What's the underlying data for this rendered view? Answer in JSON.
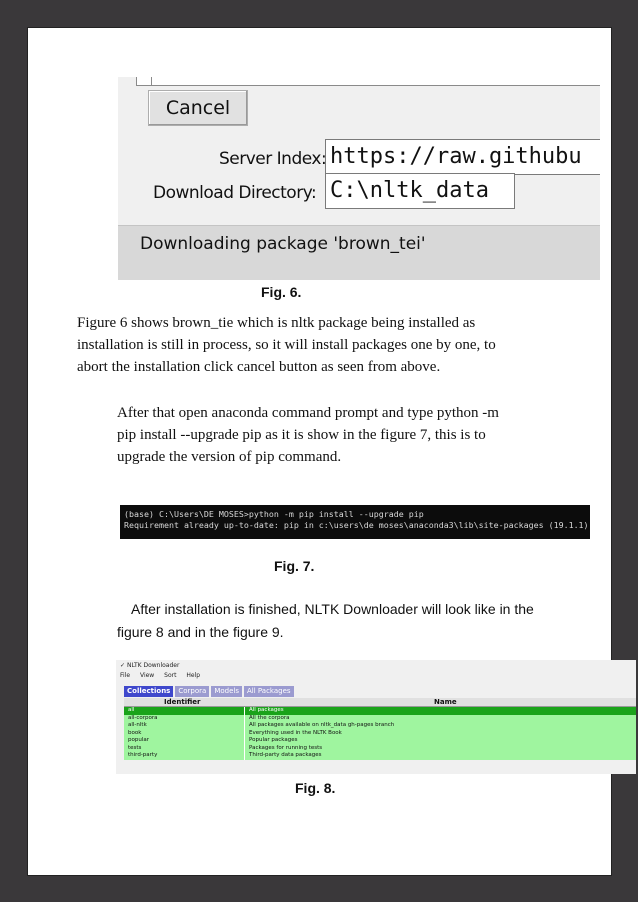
{
  "fig6": {
    "cancel_label": "Cancel",
    "server_index_label": "Server Index:",
    "server_index_value": "https://raw.githubu",
    "download_dir_label": "Download Directory:",
    "download_dir_value": "C:\\nltk_data",
    "status_text": "Downloading package 'brown_tei'",
    "caption": "Fig. 6."
  },
  "para1": {
    "line1": "Figure 6 shows brown_tie which is nltk package being installed as",
    "line2": "installation is still in process, so it will install packages one by one, to",
    "line3": "abort the installation click cancel button as seen from above."
  },
  "para2": {
    "line1": "After that open anaconda command prompt and type python -m",
    "line2": "pip install --upgrade pip as it is show in the figure 7, this is to",
    "line3": "upgrade the version of pip command."
  },
  "fig7": {
    "line1": "(base) C:\\Users\\DE MOSES>python -m pip install --upgrade pip",
    "line2": "Requirement already up-to-date: pip in c:\\users\\de moses\\anaconda3\\lib\\site-packages (19.1.1)",
    "caption": "Fig. 7."
  },
  "para3": {
    "line1": "After installation is finished, NLTK Downloader will look like in the",
    "line2": "figure 8 and in the figure 9."
  },
  "fig8": {
    "window_title": "NLTK Downloader",
    "menu": [
      "File",
      "View",
      "Sort",
      "Help"
    ],
    "tabs": [
      "Collections",
      "Corpora",
      "Models",
      "All Packages"
    ],
    "columns": [
      "Identifier",
      "Name"
    ],
    "rows": [
      {
        "id": "all",
        "name": "All packages"
      },
      {
        "id": "all-corpora",
        "name": "All the corpora"
      },
      {
        "id": "all-nltk",
        "name": "All packages available on nltk_data gh-pages branch"
      },
      {
        "id": "book",
        "name": "Everything used in the NLTK Book"
      },
      {
        "id": "popular",
        "name": "Popular packages"
      },
      {
        "id": "tests",
        "name": "Packages for running tests"
      },
      {
        "id": "third-party",
        "name": "Third-party data packages"
      }
    ],
    "caption": "Fig. 8."
  }
}
